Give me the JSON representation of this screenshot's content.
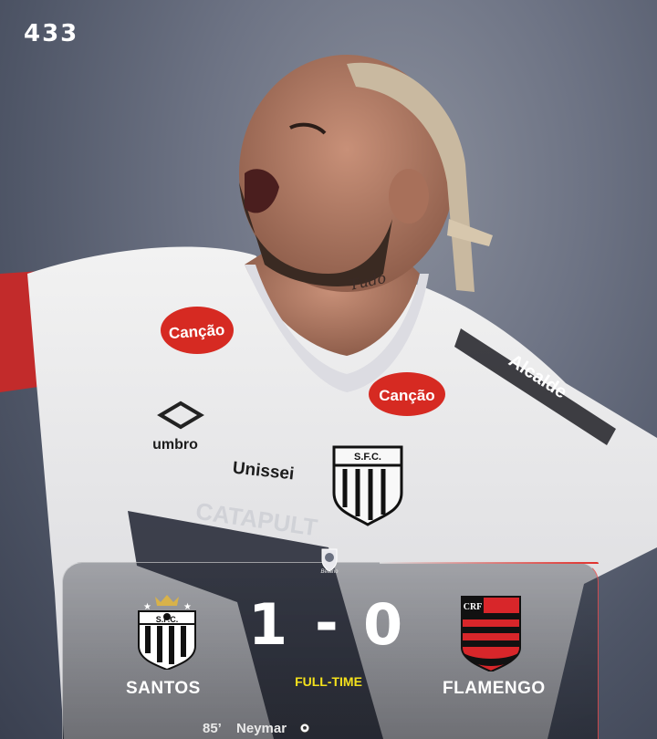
{
  "brand": {
    "name": "433"
  },
  "shirt": {
    "sponsor_front": "Canção",
    "sponsor_chest": "Canção",
    "kit_maker": "umbro",
    "sponsor_belly": "Unissei",
    "sleeve_sponsor": "Alcalde",
    "bottom_sponsor": "CATAPULT",
    "crest_text": "S.F.C."
  },
  "league": {
    "name": "Betano"
  },
  "match": {
    "home": {
      "name": "SANTOS",
      "score": "1",
      "crest_text": "S.F.C."
    },
    "away": {
      "name": "FLAMENGO",
      "score": "0",
      "crest_text": "CRF"
    },
    "separator": "-",
    "status": "FULL-TIME",
    "goals": [
      {
        "minute": "85’",
        "player": "Neymar"
      }
    ]
  },
  "colors": {
    "status": "#f4e11c",
    "flamengo_red": "#d8262a",
    "flamengo_black": "#111111",
    "panel_border": "#ffffff"
  }
}
